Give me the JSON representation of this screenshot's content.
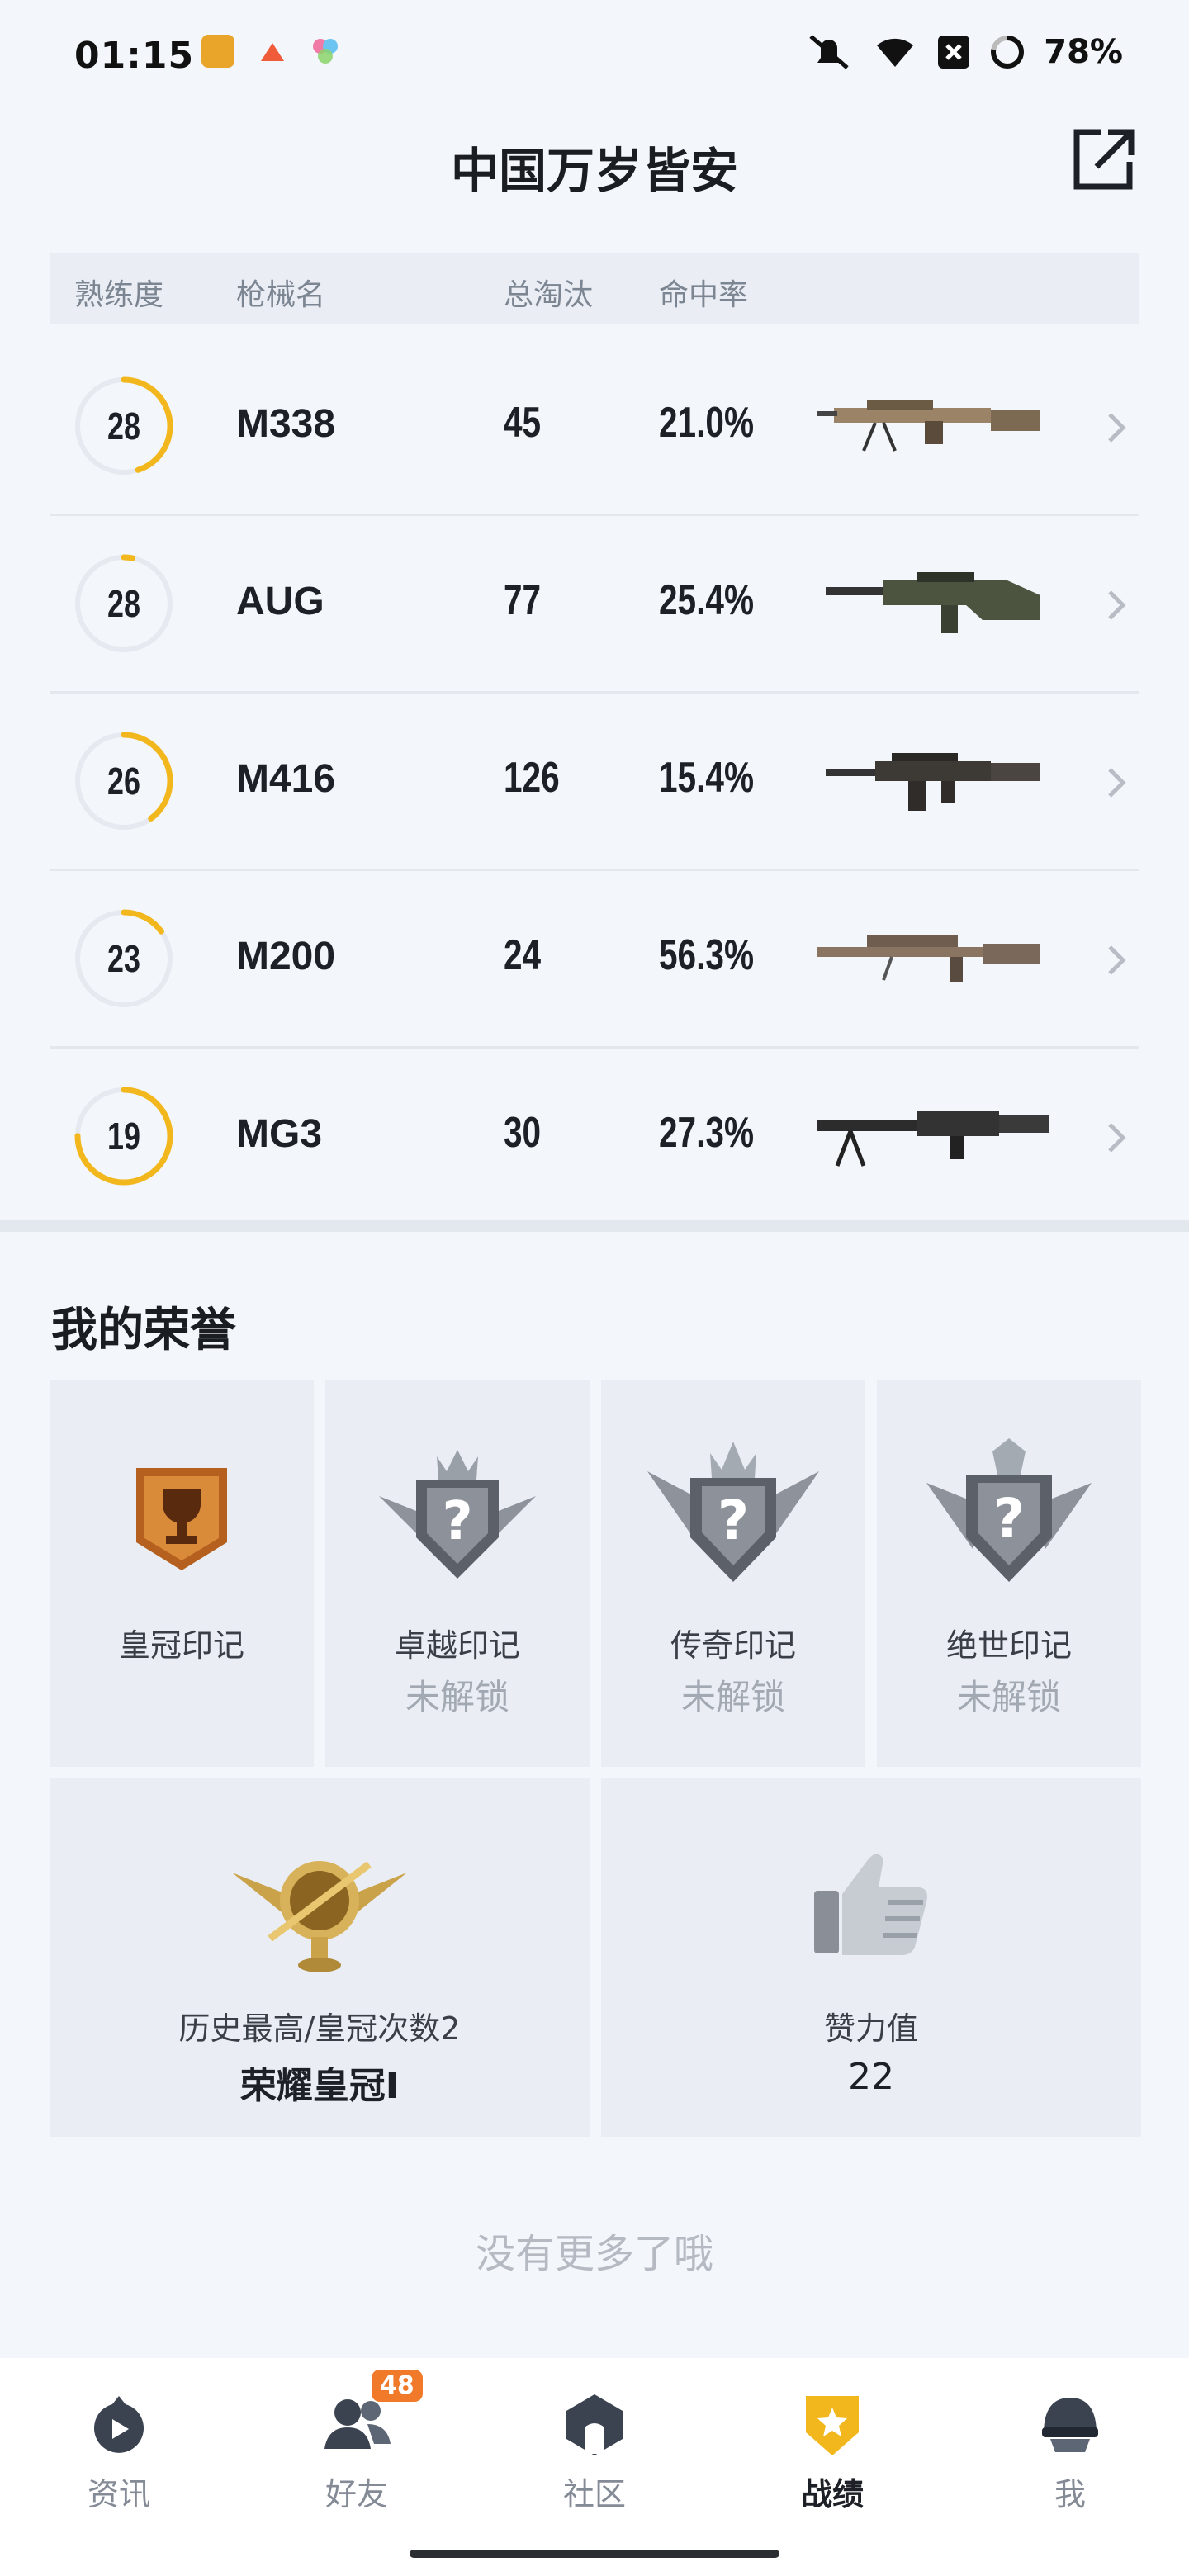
{
  "status_bar": {
    "time": "01:15",
    "battery": "78%"
  },
  "header": {
    "title": "中国万岁皆安"
  },
  "table": {
    "columns": [
      "熟练度",
      "枪械名",
      "总淘汰",
      "命中率"
    ],
    "rows": [
      {
        "level": "28",
        "progress": 0.45,
        "name": "M338",
        "kills": "45",
        "rate": "21.0%",
        "gun": "m338-rifle-icon"
      },
      {
        "level": "28",
        "progress": 0.03,
        "name": "AUG",
        "kills": "77",
        "rate": "25.4%",
        "gun": "aug-rifle-icon"
      },
      {
        "level": "26",
        "progress": 0.4,
        "name": "M416",
        "kills": "126",
        "rate": "15.4%",
        "gun": "m416-rifle-icon"
      },
      {
        "level": "23",
        "progress": 0.15,
        "name": "M200",
        "kills": "24",
        "rate": "56.3%",
        "gun": "m200-sniper-icon"
      },
      {
        "level": "19",
        "progress": 0.75,
        "name": "MG3",
        "kills": "30",
        "rate": "27.3%",
        "gun": "mg3-machinegun-icon"
      }
    ]
  },
  "honors": {
    "title": "我的荣誉",
    "badges": [
      {
        "name": "皇冠印记",
        "status": ""
      },
      {
        "name": "卓越印记",
        "status": "未解锁"
      },
      {
        "name": "传奇印记",
        "status": "未解锁"
      },
      {
        "name": "绝世印记",
        "status": "未解锁"
      }
    ],
    "highest": {
      "label": "历史最高/皇冠次数2",
      "value": "荣耀皇冠Ⅰ"
    },
    "likes": {
      "label": "赞力值",
      "value": "22"
    }
  },
  "footer_text": "没有更多了哦",
  "tabbar": {
    "items": [
      {
        "label": "资讯",
        "icon": "news-icon"
      },
      {
        "label": "好友",
        "icon": "friends-icon",
        "badge": "48"
      },
      {
        "label": "社区",
        "icon": "community-icon"
      },
      {
        "label": "战绩",
        "icon": "record-icon",
        "active": true
      },
      {
        "label": "我",
        "icon": "profile-helmet-icon"
      }
    ]
  },
  "colors": {
    "accent": "#f2b71c",
    "ring_track": "#e6e9ef"
  }
}
